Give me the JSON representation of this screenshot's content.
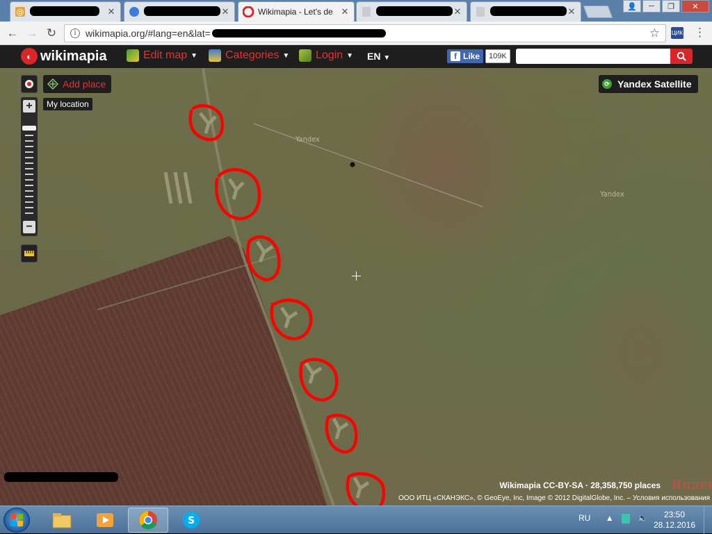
{
  "browser": {
    "tabs": [
      {
        "title": "",
        "favicon": "mail-at-icon",
        "redacted": true
      },
      {
        "title": "",
        "favicon": "globe-icon",
        "redacted": true
      },
      {
        "title": "Wikimapia - Let's de",
        "favicon": "wikimapia-icon",
        "redacted": false,
        "active": true
      },
      {
        "title": "",
        "favicon": "page-icon",
        "redacted": true
      },
      {
        "title": "",
        "favicon": "page-icon",
        "redacted": true
      }
    ],
    "url": "wikimapia.org/#lang=en&lat=",
    "window_controls": [
      "user-icon",
      "minimize-icon",
      "maximize-icon",
      "close-icon"
    ]
  },
  "wikimapia": {
    "logo": "wikimapia",
    "menu": {
      "edit_map": "Edit map",
      "categories": "Categories",
      "login": "Login",
      "language": "EN"
    },
    "fb_like": "Like",
    "fb_count": "109K",
    "search_placeholder": ""
  },
  "map": {
    "add_place": "Add place",
    "my_location_tooltip": "My location",
    "layer": "Yandex Satellite",
    "watermarks": [
      "Yandex",
      "Yandex"
    ],
    "credit_line": "Wikimapia CC-BY-SA",
    "places_count": "28,358,750 places",
    "imagery_credit": "ООО ИТЦ «СКАНЭКС», © GeoEye, Inc, Image © 2012 DigitalGlobe, Inc. – Условия использования",
    "yandex_logo": "Яндекс",
    "highlight_color": "#ff0000"
  },
  "taskbar": {
    "apps": [
      "file-explorer-icon",
      "media-player-icon",
      "chrome-icon",
      "skype-icon"
    ],
    "language": "RU",
    "time": "23:50",
    "date": "28.12.2016"
  }
}
